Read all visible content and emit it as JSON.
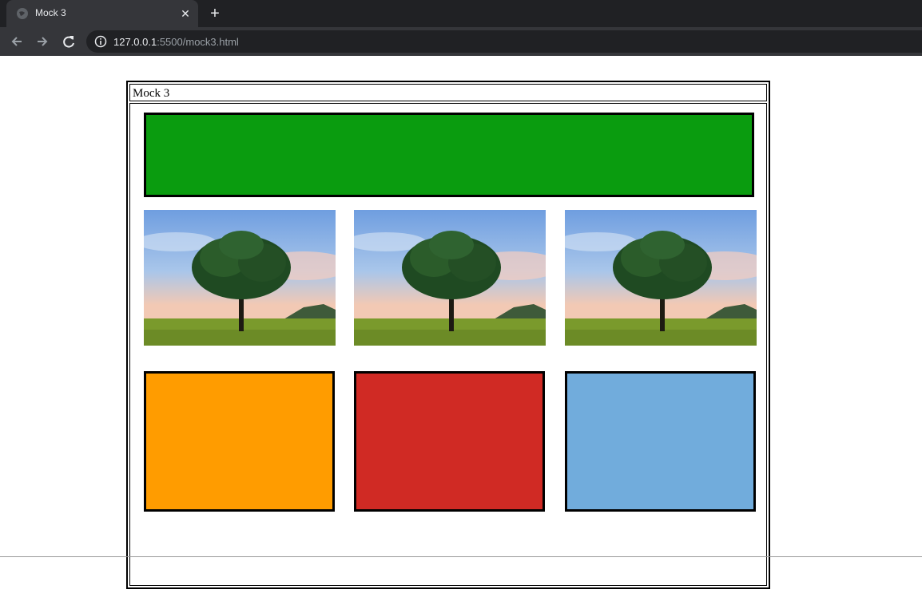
{
  "browser": {
    "tab_title": "Mock 3",
    "url_host": "127.0.0.1",
    "url_rest": ":5500/mock3.html"
  },
  "page": {
    "caption": "Mock 3",
    "colors": {
      "green_bar": "#0a9c0f",
      "orange_box": "#ff9c00",
      "red_box": "#d02a24",
      "blue_box": "#71acdc"
    },
    "images": [
      "tree-photo",
      "tree-photo",
      "tree-photo"
    ]
  }
}
